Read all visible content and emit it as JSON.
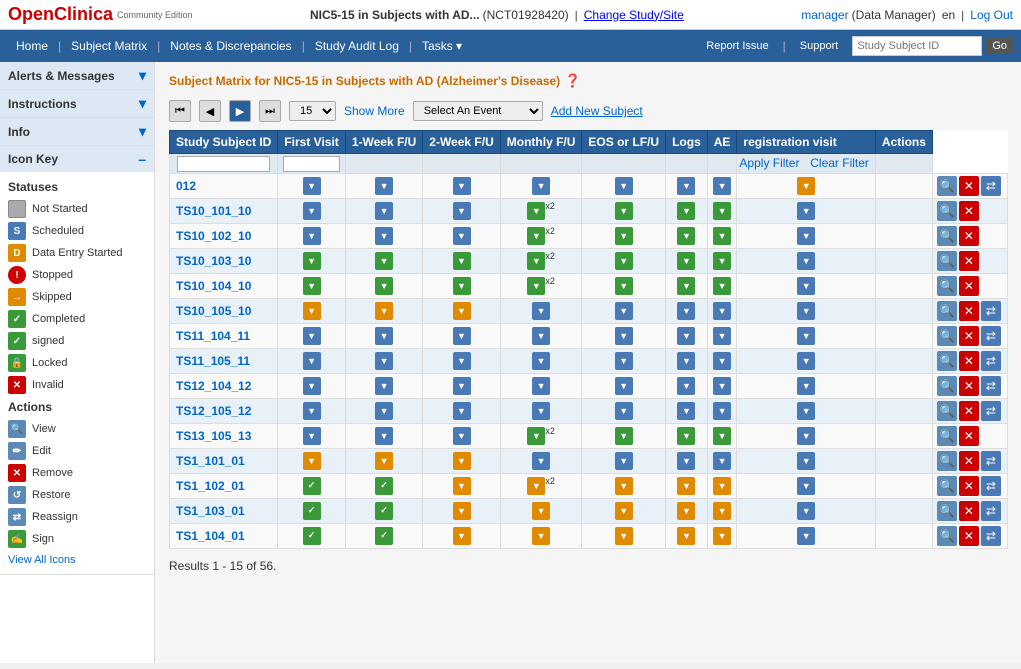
{
  "app": {
    "logo": "OpenClinica",
    "logo_sub": "Community Edition",
    "study_title": "NIC5-15 in Subjects with AD...",
    "nct_id": "(NCT01928420)",
    "change_link": "Change Study/Site",
    "user": "manager",
    "user_role": "(Data Manager)",
    "lang": "en",
    "logout": "Log Out"
  },
  "nav": {
    "items": [
      "Home",
      "Subject Matrix",
      "Notes & Discrepancies",
      "Study Audit Log",
      "Tasks"
    ],
    "tasks_arrow": "▾",
    "report_issue": "Report Issue",
    "support": "Support",
    "search_placeholder": "Study Subject ID",
    "go_label": "Go"
  },
  "sidebar": {
    "alerts_messages": "Alerts & Messages",
    "instructions": "Instructions",
    "info": "Info",
    "icon_key": "Icon Key",
    "statuses_label": "Statuses",
    "statuses": [
      {
        "color": "#aaa",
        "label": "Not Started"
      },
      {
        "color": "#4a7ab5",
        "label": "Scheduled"
      },
      {
        "color": "#e08a00",
        "label": "Data Entry Started"
      },
      {
        "color": "#c00",
        "label": "Stopped"
      },
      {
        "color": "#e08a00",
        "label": "Skipped"
      },
      {
        "color": "#3a9a3a",
        "label": "Completed"
      },
      {
        "color": "#3a9a3a",
        "label": "signed"
      },
      {
        "color": "#3a9a3a",
        "label": "Locked"
      },
      {
        "color": "#c00",
        "label": "Invalid"
      }
    ],
    "actions_label": "Actions",
    "actions": [
      {
        "label": "View"
      },
      {
        "label": "Edit"
      },
      {
        "label": "Remove"
      },
      {
        "label": "Restore"
      },
      {
        "label": "Reassign"
      },
      {
        "label": "Sign"
      }
    ],
    "view_all_icons": "View All Icons"
  },
  "main": {
    "page_title": "Subject Matrix for NIC5-15 in Subjects with AD (Alzheimer's Disease)",
    "per_page": "15",
    "show_more": "Show More",
    "select_event_placeholder": "Select An Event",
    "add_new_subject": "Add New Subject",
    "apply_filter": "Apply Filter",
    "clear_filter": "Clear Filter",
    "columns": [
      "Study Subject ID",
      "First Visit",
      "1-Week F/U",
      "2-Week F/U",
      "Monthly F/U",
      "EOS or LF/U",
      "Logs",
      "AE",
      "registration visit",
      "Actions"
    ],
    "rows": [
      {
        "id": "012",
        "cells": [
          "blue",
          "blue",
          "blue",
          "blue",
          "blue",
          "blue",
          "blue",
          "orange",
          ""
        ],
        "actions": [
          "view",
          "remove",
          "reassign"
        ]
      },
      {
        "id": "TS10_101_10",
        "cells": [
          "blue",
          "blue",
          "blue",
          "green-x2",
          "green",
          "green",
          "green",
          "blue",
          ""
        ],
        "actions": [
          "view",
          "remove"
        ]
      },
      {
        "id": "TS10_102_10",
        "cells": [
          "blue",
          "blue",
          "blue",
          "green-x2",
          "green",
          "green",
          "green",
          "blue",
          ""
        ],
        "actions": [
          "view",
          "remove"
        ]
      },
      {
        "id": "TS10_103_10",
        "cells": [
          "green",
          "green",
          "green",
          "green-x2",
          "green",
          "green",
          "green",
          "blue",
          ""
        ],
        "actions": [
          "view",
          "remove"
        ]
      },
      {
        "id": "TS10_104_10",
        "cells": [
          "green",
          "green",
          "green",
          "green-x2",
          "green",
          "green",
          "green",
          "blue",
          ""
        ],
        "actions": [
          "view",
          "remove"
        ]
      },
      {
        "id": "TS10_105_10",
        "cells": [
          "orange",
          "orange",
          "orange",
          "blue",
          "blue",
          "blue",
          "blue",
          "blue",
          ""
        ],
        "actions": [
          "view",
          "remove",
          "reassign"
        ]
      },
      {
        "id": "TS11_104_11",
        "cells": [
          "blue",
          "blue",
          "blue",
          "blue",
          "blue",
          "blue",
          "blue",
          "blue",
          ""
        ],
        "actions": [
          "view",
          "remove",
          "reassign"
        ]
      },
      {
        "id": "TS11_105_11",
        "cells": [
          "blue",
          "blue",
          "blue",
          "blue",
          "blue",
          "blue",
          "blue",
          "blue",
          ""
        ],
        "actions": [
          "view",
          "remove",
          "reassign"
        ]
      },
      {
        "id": "TS12_104_12",
        "cells": [
          "blue",
          "blue",
          "blue",
          "blue",
          "blue",
          "blue",
          "blue",
          "blue",
          ""
        ],
        "actions": [
          "view",
          "remove",
          "reassign"
        ]
      },
      {
        "id": "TS12_105_12",
        "cells": [
          "blue",
          "blue",
          "blue",
          "blue",
          "blue",
          "blue",
          "blue",
          "blue",
          ""
        ],
        "actions": [
          "view",
          "remove",
          "reassign"
        ]
      },
      {
        "id": "TS13_105_13",
        "cells": [
          "blue",
          "blue",
          "blue",
          "green-x2",
          "green",
          "green",
          "green",
          "blue",
          ""
        ],
        "actions": [
          "view",
          "remove"
        ]
      },
      {
        "id": "TS1_101_01",
        "cells": [
          "orange",
          "orange",
          "orange",
          "blue",
          "blue",
          "blue",
          "blue",
          "blue",
          ""
        ],
        "actions": [
          "view",
          "remove",
          "reassign"
        ]
      },
      {
        "id": "TS1_102_01",
        "cells": [
          "check",
          "check",
          "orange",
          "orange-x2",
          "orange",
          "orange",
          "orange",
          "blue",
          ""
        ],
        "actions": [
          "view",
          "remove",
          "reassign"
        ]
      },
      {
        "id": "TS1_103_01",
        "cells": [
          "check",
          "check",
          "orange",
          "orange",
          "orange",
          "orange",
          "orange",
          "blue",
          ""
        ],
        "actions": [
          "view",
          "remove",
          "reassign"
        ]
      },
      {
        "id": "TS1_104_01",
        "cells": [
          "check",
          "check",
          "orange",
          "orange",
          "orange",
          "orange",
          "orange",
          "blue",
          ""
        ],
        "actions": [
          "view",
          "remove",
          "reassign"
        ]
      }
    ],
    "results_text": "Results 1 - 15 of 56."
  }
}
